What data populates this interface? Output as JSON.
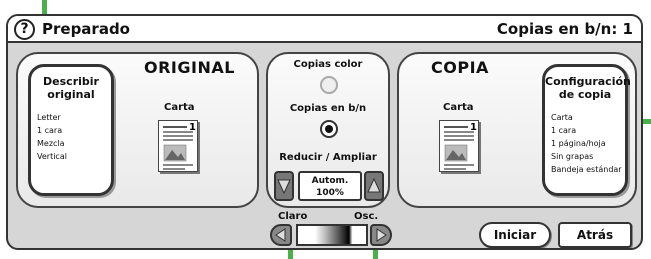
{
  "header": {
    "help_icon": "?",
    "status": "Preparado",
    "copy_count": "Copias en b/n: 1"
  },
  "original": {
    "button_title": "Describir original",
    "settings": [
      "Letter",
      "1 cara",
      "Mezcla",
      "Vertical"
    ],
    "panel_title": "ORIGINAL",
    "paper_label": "Carta"
  },
  "center": {
    "color_label": "Copias color",
    "bw_label": "Copias en b/n",
    "zoom_label": "Reducir / Ampliar",
    "zoom_value_line1": "Autom.",
    "zoom_value_line2": "100%",
    "light_label": "Claro",
    "dark_label": "Osc.",
    "selected_mode": "Copias en b/n"
  },
  "copy": {
    "panel_title": "COPIA",
    "paper_label": "Carta",
    "button_title": "Configuración de copia",
    "settings": [
      "Carta",
      "1 cara",
      "1 página/hoja",
      "Sin grapas",
      "Bandeja estándar"
    ]
  },
  "actions": {
    "start": "Iniciar",
    "back": "Atrás"
  },
  "colors": {
    "callout": "#4ab04a",
    "screen_bg": "#d6d6d6",
    "border": "#333333"
  }
}
